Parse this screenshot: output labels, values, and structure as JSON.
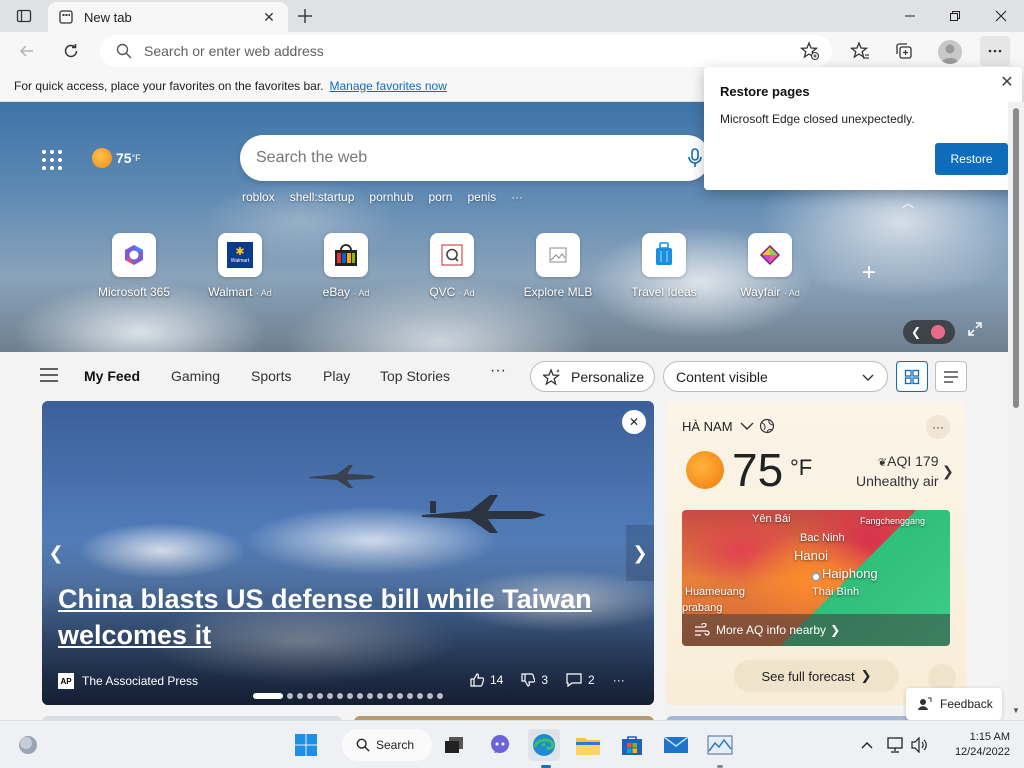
{
  "browser": {
    "tab_title": "New tab",
    "address_placeholder": "Search or enter web address"
  },
  "favbar": {
    "text": "For quick access, place your favorites on the favorites bar.",
    "link": "Manage favorites now"
  },
  "restore": {
    "title": "Restore pages",
    "message": "Microsoft Edge closed unexpectedly.",
    "button": "Restore"
  },
  "hero": {
    "weather_temp": "75",
    "weather_unit": "°F",
    "search_placeholder": "Search the web",
    "trending": [
      "roblox",
      "shell:startup",
      "pornhub",
      "porn",
      "penis"
    ],
    "trending_more": "···",
    "tiles": [
      {
        "label": "Microsoft 365",
        "ad": ""
      },
      {
        "label": "Walmart",
        "ad": "· Ad"
      },
      {
        "label": "eBay",
        "ad": "· Ad"
      },
      {
        "label": "QVC",
        "ad": "· Ad"
      },
      {
        "label": "Explore MLB",
        "ad": ""
      },
      {
        "label": "Travel Ideas",
        "ad": ""
      },
      {
        "label": "Wayfair",
        "ad": "· Ad"
      }
    ],
    "walmart_icon_text": "Walmart"
  },
  "feed": {
    "tabs": [
      "My Feed",
      "Gaming",
      "Sports",
      "Play",
      "Top Stories"
    ],
    "more": "···",
    "personalize": "Personalize",
    "content_select": "Content visible"
  },
  "article": {
    "headline": "China blasts US defense bill while Taiwan welcomes it",
    "source": "The Associated Press",
    "source_logo": "AP",
    "likes": "14",
    "dislikes": "3",
    "comments": "2",
    "more": "···"
  },
  "weather": {
    "location": "HÀ NAM",
    "temp": "75",
    "unit": "°F",
    "aqi": "AQI 179",
    "aqi_status": "Unhealthy air",
    "map_labels": {
      "yen_bai": "Yên Bái",
      "fangchenggang": "Fangchenggang",
      "bac_ninh": "Bac Ninh",
      "hanoi": "Hanoi",
      "haiphong": "Haiphong",
      "huameuang": "Huameuang",
      "thai_binh": "Thái Bình",
      "prabang": "prabang"
    },
    "map_link": "More AQ info nearby",
    "forecast_button": "See full forecast",
    "more": "···"
  },
  "feedback": "Feedback",
  "taskbar": {
    "search": "Search",
    "time": "1:15 AM",
    "date": "12/24/2022"
  },
  "colors": {
    "accent": "#0f6cbd",
    "edge_blue": "#1f8ad2",
    "edge_green": "#3ac16b"
  }
}
